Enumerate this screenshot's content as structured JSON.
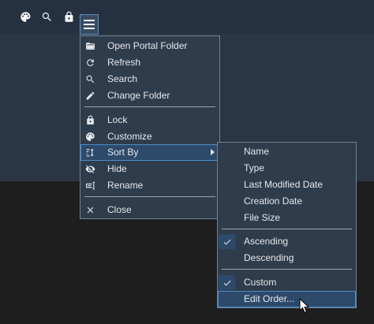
{
  "toolbar": {
    "icons": [
      "palette-icon",
      "search-icon",
      "lock-icon",
      "hamburger-menu-icon"
    ]
  },
  "main_menu": {
    "items": [
      {
        "label": "Open Portal Folder",
        "icon": "folder-open-icon"
      },
      {
        "label": "Refresh",
        "icon": "refresh-icon"
      },
      {
        "label": "Search",
        "icon": "search-icon"
      },
      {
        "label": "Change Folder",
        "icon": "pencil-icon"
      },
      {
        "label": "Lock",
        "icon": "lock-icon"
      },
      {
        "label": "Customize",
        "icon": "palette-icon"
      },
      {
        "label": "Sort By",
        "icon": "sort-icon",
        "has_submenu": true,
        "highlighted": true
      },
      {
        "label": "Hide",
        "icon": "eye-off-icon"
      },
      {
        "label": "Rename",
        "icon": "rename-icon"
      },
      {
        "label": "Close",
        "icon": "close-icon"
      }
    ]
  },
  "sort_submenu": {
    "items": [
      {
        "label": "Name"
      },
      {
        "label": "Type"
      },
      {
        "label": "Last Modified Date"
      },
      {
        "label": "Creation Date"
      },
      {
        "label": "File Size"
      },
      {
        "label": "Ascending",
        "checked": true
      },
      {
        "label": "Descending",
        "checked": false
      },
      {
        "label": "Custom",
        "checked": true
      },
      {
        "label": "Edit Order...",
        "highlighted": true
      }
    ]
  },
  "colors": {
    "background": "#1e1e1e",
    "portal_panel": "#2b3644",
    "menu_bg": "#2f3c4c",
    "menu_border": "#6f8194",
    "highlight_bg": "#2d4a6b",
    "highlight_border": "#4a8ec8",
    "text": "#e6e9ec"
  }
}
